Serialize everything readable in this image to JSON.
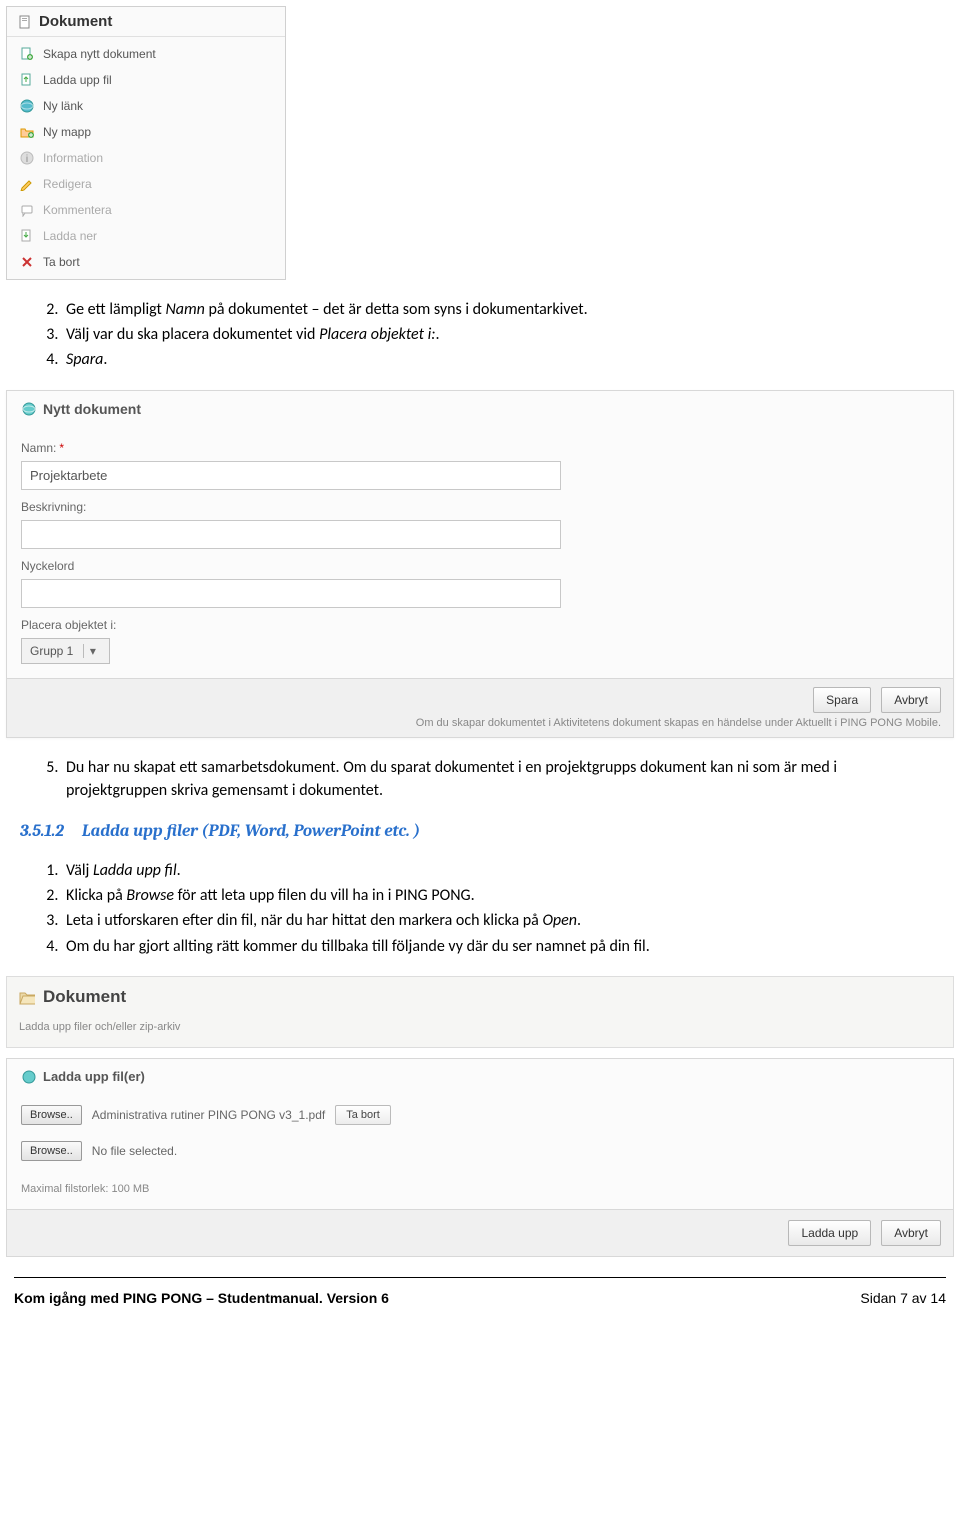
{
  "panel1": {
    "title": "Dokument",
    "menu": [
      {
        "label": "Skapa nytt dokument",
        "icon": "new-doc"
      },
      {
        "label": "Ladda upp fil",
        "icon": "upload"
      },
      {
        "label": "Ny länk",
        "icon": "link"
      },
      {
        "label": "Ny mapp",
        "icon": "folder"
      },
      {
        "label": "Information",
        "icon": "info"
      },
      {
        "label": "Redigera",
        "icon": "edit"
      },
      {
        "label": "Kommentera",
        "icon": "comment"
      },
      {
        "label": "Ladda ner",
        "icon": "download"
      },
      {
        "label": "Ta bort",
        "icon": "delete"
      }
    ]
  },
  "instructions1": {
    "l2a": "Ge ett lämpligt ",
    "l2b": "Namn",
    "l2c": " på dokumentet – det är detta som syns i dokumentarkivet.",
    "l3a": "Välj var du ska placera dokumentet vid ",
    "l3b": "Placera objektet i:",
    "l3c": ".",
    "l4a": "Spara",
    "l4b": "."
  },
  "form": {
    "heading": "Nytt dokument",
    "labels": {
      "name": "Namn:",
      "desc": "Beskrivning:",
      "keywords": "Nyckelord",
      "place": "Placera objektet i:"
    },
    "name_value": "Projektarbete",
    "desc_value": "",
    "keywords_value": "",
    "select_value": "Grupp 1",
    "buttons": {
      "save": "Spara",
      "cancel": "Avbryt"
    },
    "hint": "Om du skapar dokumentet i Aktivitetens dokument skapas en händelse under Aktuellt i PING PONG Mobile."
  },
  "instructions2": {
    "p5": "Du har nu skapat ett samarbetsdokument. Om du sparat dokumentet i en projektgrupps dokument kan ni som är med i projektgruppen skriva gemensamt i dokumentet."
  },
  "section": {
    "number": "3.5.1.2",
    "title": "Ladda upp filer (PDF, Word, PowerPoint etc. )"
  },
  "instructions3": {
    "l1a": "Välj ",
    "l1b": "Ladda upp fil",
    "l1c": ".",
    "l2a": "Klicka på ",
    "l2b": "Browse",
    "l2c": " för att leta upp filen du vill ha in i PING PONG.",
    "l3a": "Leta i utforskaren efter din fil, när du har hittat den markera och klicka på ",
    "l3b": "Open",
    "l3c": ".",
    "l4": "Om du har gjort allting rätt kommer du tillbaka till följande vy där du ser namnet på din fil."
  },
  "panel2": {
    "title": "Dokument",
    "subtitle": "Ladda upp filer och/eller zip-arkiv"
  },
  "upload": {
    "heading": "Ladda upp fil(er)",
    "browse": "Browse..",
    "file1": "Administrativa rutiner PING PONG v3_1.pdf",
    "remove": "Ta bort",
    "nofile": "No file selected.",
    "max": "Maximal filstorlek: 100 MB",
    "buttons": {
      "up": "Ladda upp",
      "cancel": "Avbryt"
    }
  },
  "footer": {
    "left": "Kom igång med PING PONG – Studentmanual. Version 6",
    "right": "Sidan 7 av 14"
  }
}
